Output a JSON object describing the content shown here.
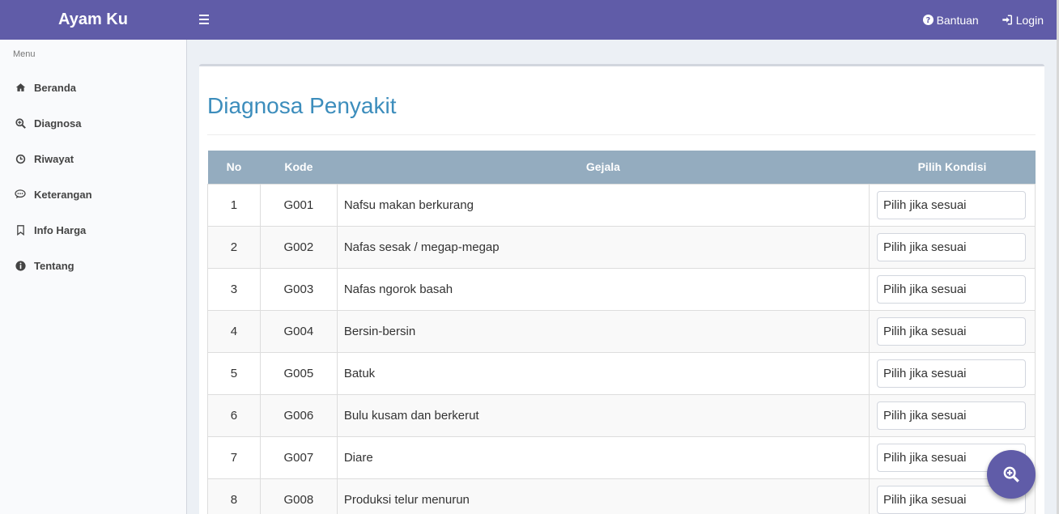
{
  "header": {
    "brand": "Ayam Ku",
    "help_label": "Bantuan",
    "login_label": "Login",
    "color": "#605ca8"
  },
  "sidebar": {
    "menu_header": "Menu",
    "items": [
      {
        "label": "Beranda",
        "icon": "home-icon"
      },
      {
        "label": "Diagnosa",
        "icon": "search-plus-icon"
      },
      {
        "label": "Riwayat",
        "icon": "history-icon"
      },
      {
        "label": "Keterangan",
        "icon": "comment-icon"
      },
      {
        "label": "Info Harga",
        "icon": "bookmark-icon"
      },
      {
        "label": "Tentang",
        "icon": "info-circle-icon"
      }
    ]
  },
  "main": {
    "title": "Diagnosa Penyakit",
    "table": {
      "headers": [
        "No",
        "Kode",
        "Gejala",
        "Pilih Kondisi"
      ],
      "select_placeholder": "Pilih jika sesuai",
      "rows": [
        {
          "no": "1",
          "kode": "G001",
          "gejala": "Nafsu makan berkurang",
          "kondisi": "Pilih jika sesuai"
        },
        {
          "no": "2",
          "kode": "G002",
          "gejala": "Nafas sesak / megap-megap",
          "kondisi": "Pilih jika sesuai"
        },
        {
          "no": "3",
          "kode": "G003",
          "gejala": "Nafas ngorok basah",
          "kondisi": "Pilih jika sesuai"
        },
        {
          "no": "4",
          "kode": "G004",
          "gejala": "Bersin-bersin",
          "kondisi": "Pilih jika sesuai"
        },
        {
          "no": "5",
          "kode": "G005",
          "gejala": "Batuk",
          "kondisi": "Pilih jika sesuai"
        },
        {
          "no": "6",
          "kode": "G006",
          "gejala": "Bulu kusam dan berkerut",
          "kondisi": "Pilih jika sesuai"
        },
        {
          "no": "7",
          "kode": "G007",
          "gejala": "Diare",
          "kondisi": "Pilih jika sesuai"
        },
        {
          "no": "8",
          "kode": "G008",
          "gejala": "Produksi telur menurun",
          "kondisi": "Pilih jika sesuai"
        }
      ]
    }
  },
  "fab": {
    "icon": "search-plus-icon"
  }
}
